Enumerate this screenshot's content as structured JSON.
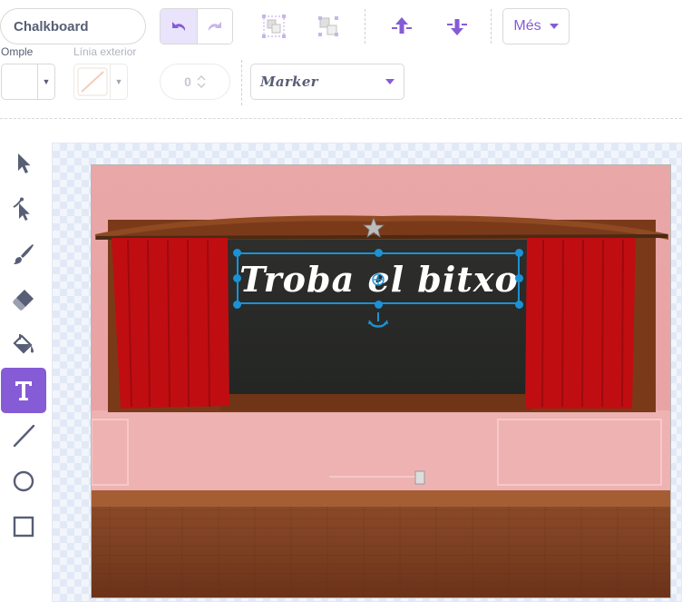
{
  "costume": {
    "name": "Chalkboard"
  },
  "toolbar": {
    "undo_icon": "undo-icon",
    "redo_icon": "redo-icon",
    "group_icon": "group-icon",
    "ungroup_icon": "ungroup-icon",
    "forward_icon": "forward-icon",
    "backward_icon": "backward-icon",
    "more_label": "Més"
  },
  "fill": {
    "label": "Omple",
    "color": "#ffffff"
  },
  "outline": {
    "label": "Línia exterior",
    "color": "none"
  },
  "stroke_width": {
    "value": "0"
  },
  "font": {
    "selected": "Marker"
  },
  "tools": [
    {
      "name": "select",
      "icon": "select-arrow-icon",
      "active": false
    },
    {
      "name": "reshape",
      "icon": "reshape-icon",
      "active": false
    },
    {
      "name": "brush",
      "icon": "brush-icon",
      "active": false
    },
    {
      "name": "eraser",
      "icon": "eraser-icon",
      "active": false
    },
    {
      "name": "fill",
      "icon": "fill-bucket-icon",
      "active": false
    },
    {
      "name": "text",
      "icon": "text-icon",
      "active": true
    },
    {
      "name": "line",
      "icon": "line-icon",
      "active": false
    },
    {
      "name": "circle",
      "icon": "circle-icon",
      "active": false
    },
    {
      "name": "rectangle",
      "icon": "rectangle-icon",
      "active": false
    }
  ],
  "canvas": {
    "text_object": "Troba el bitxo"
  },
  "colors": {
    "accent": "#855cd6",
    "selection": "#1b92d6",
    "text_gray": "#575e75"
  }
}
